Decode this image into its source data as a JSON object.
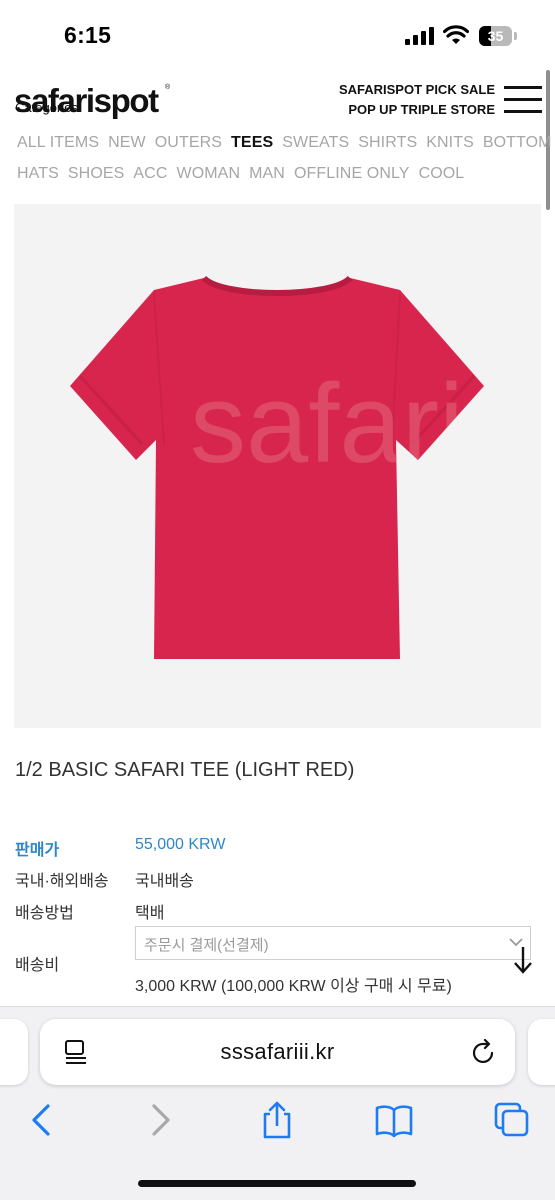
{
  "status_bar": {
    "time": "6:15",
    "battery": "35",
    "battery_level": 0.35
  },
  "header": {
    "logo": "safarispot",
    "logo_mark": "®",
    "categories_label": "Categories",
    "promo_lines": [
      "SAFARISPOT PICK SALE",
      "POP UP TRIPLE STORE"
    ]
  },
  "categories": {
    "row1": [
      "ALL ITEMS",
      "NEW",
      "OUTERS",
      "TEES",
      "SWEATS",
      "SHIRTS",
      "KNITS",
      "BOTTOM"
    ],
    "row2": [
      "HATS",
      "SHOES",
      "ACC",
      "WOMAN",
      "MAN",
      "OFFLINE ONLY",
      "COOL"
    ],
    "active": "TEES"
  },
  "product": {
    "image_print": "safari",
    "image_color": "#d8254e",
    "title": "1/2 BASIC SAFARI TEE (LIGHT RED)",
    "price_label": "판매가",
    "price_value": "55,000 KRW",
    "shipping_region_label": "국내·해외배송",
    "shipping_region_value": "국내배송",
    "shipping_method_label": "배송방법",
    "shipping_method_value": "택배",
    "shipping_fee_label": "배송비",
    "shipping_fee_select": "주문시 결제(선결제)",
    "shipping_fee_note": "3,000 KRW (100,000 KRW 이상 구매 시 무료)"
  },
  "browser": {
    "url": "sssafariii.kr",
    "icons": [
      "page-menu-icon",
      "reload-icon",
      "back-icon",
      "forward-icon",
      "share-icon",
      "bookmarks-icon",
      "tabs-icon"
    ]
  },
  "colors": {
    "accent": "#2d87c8",
    "ios_blue": "#1e7cf2",
    "disabled": "#a8a8a8"
  }
}
